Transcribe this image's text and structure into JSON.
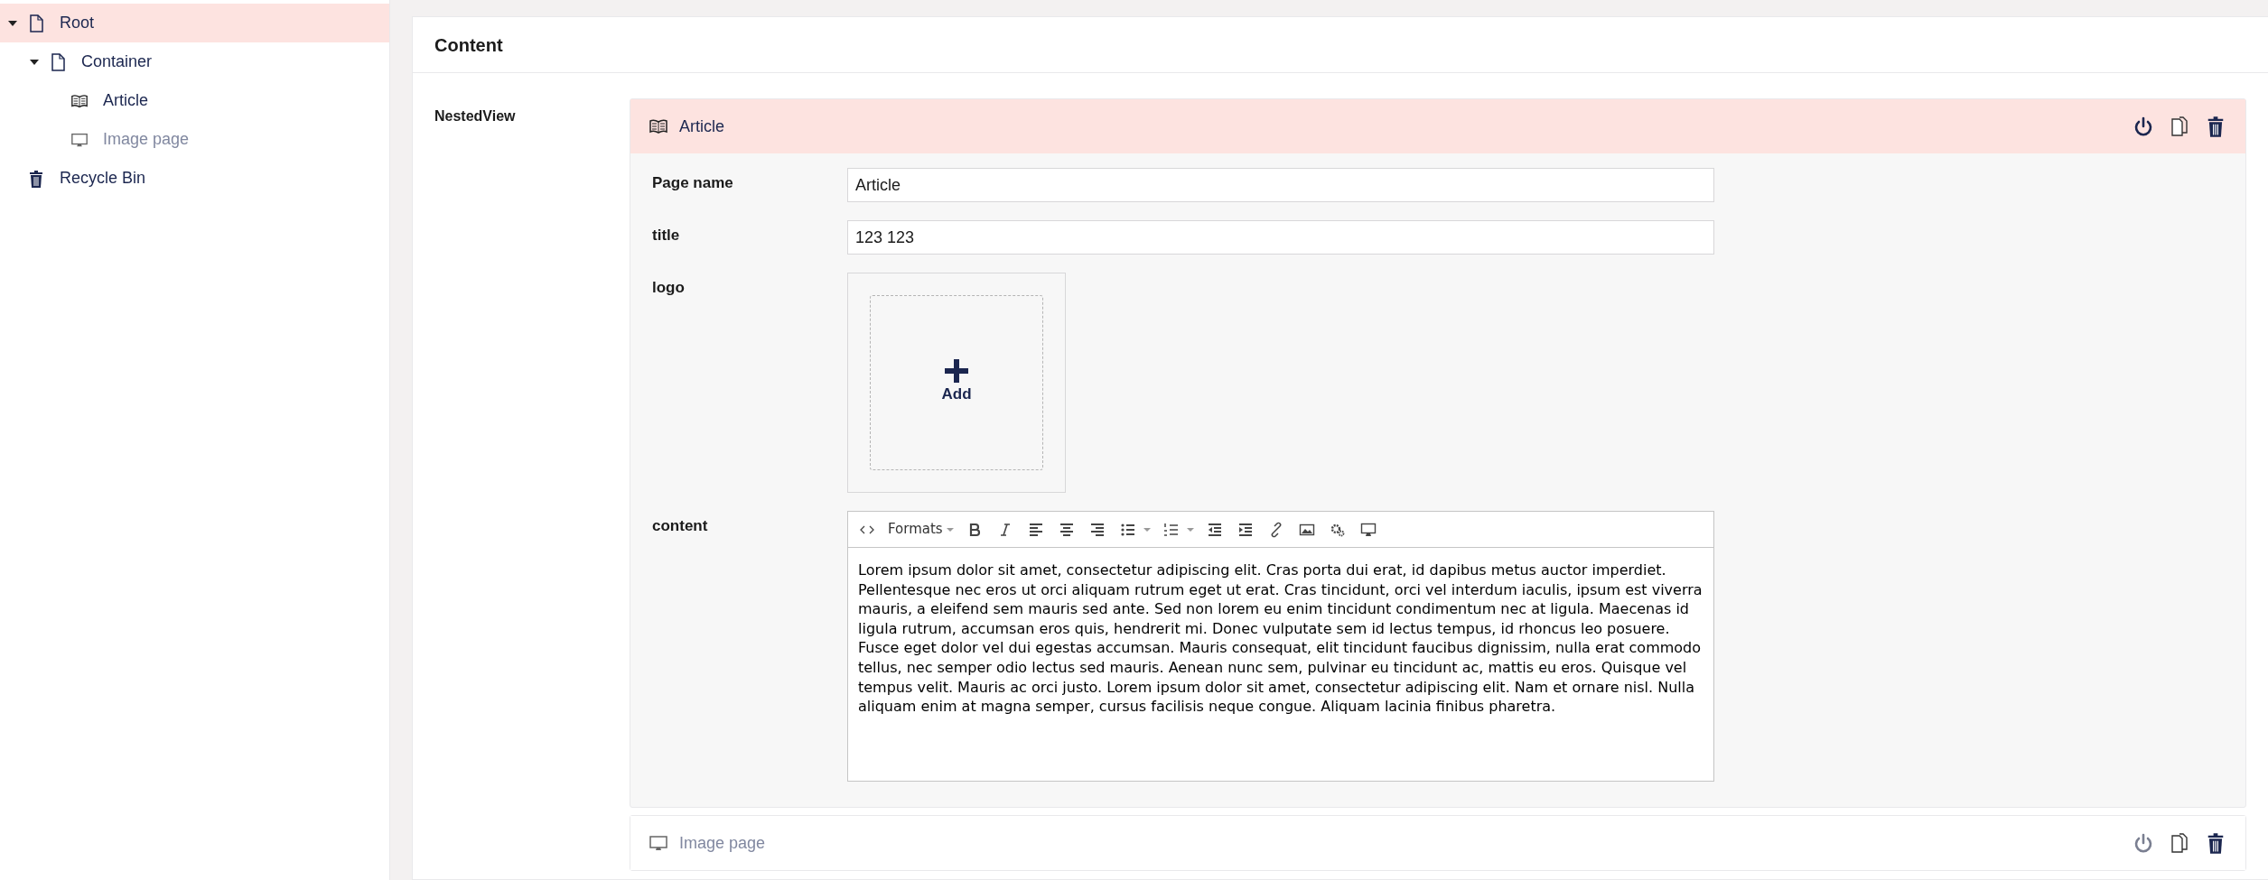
{
  "tree": [
    {
      "label": "Root",
      "kind": "page",
      "selected": true,
      "disabled": false,
      "expanded": true,
      "children": [
        {
          "label": "Container",
          "kind": "page",
          "selected": false,
          "disabled": false,
          "expanded": true,
          "children": [
            {
              "label": "Article",
              "kind": "book",
              "selected": false,
              "disabled": false
            },
            {
              "label": "Image page",
              "kind": "monitor",
              "selected": false,
              "disabled": true
            }
          ]
        }
      ]
    },
    {
      "label": "Recycle Bin",
      "kind": "trash",
      "selected": false,
      "disabled": false
    }
  ],
  "panel": {
    "title": "Content",
    "property_label": "NestedView",
    "blocks": [
      {
        "name": "Article",
        "kind": "book",
        "expanded": true,
        "published": true,
        "fields": [
          {
            "kind": "text",
            "label": "Page name",
            "value": "Article"
          },
          {
            "kind": "text",
            "label": "title",
            "value": "123 123"
          },
          {
            "kind": "media",
            "label": "logo",
            "add_label": "Add"
          },
          {
            "kind": "rte",
            "label": "content",
            "formats_label": "Formats",
            "text": "Lorem ipsum dolor sit amet, consectetur adipiscing elit. Cras porta dui erat, id dapibus metus auctor imperdiet. Pellentesque nec eros ut orci aliquam rutrum eget ut erat. Cras tincidunt, orci vel interdum iaculis, ipsum est viverra mauris, a eleifend sem mauris sed ante. Sed non lorem eu enim tincidunt condimentum nec at ligula. Maecenas id ligula rutrum, accumsan eros quis, hendrerit mi. Donec vulputate sem id lectus tempus, id rhoncus leo posuere. Fusce eget dolor vel dui egestas accumsan. Mauris consequat, elit tincidunt faucibus dignissim, nulla erat commodo tellus, nec semper odio lectus sed mauris. Aenean nunc sem, pulvinar eu tincidunt ac, mattis eu eros. Quisque vel tempus velit. Mauris ac orci justo. Lorem ipsum dolor sit amet, consectetur adipiscing elit. Nam et ornare nisl. Nulla aliquam enim at magna semper, cursus facilisis neque congue. Aliquam lacinia finibus pharetra."
          }
        ]
      },
      {
        "name": "Image page",
        "kind": "monitor",
        "expanded": false,
        "published": false
      }
    ]
  }
}
